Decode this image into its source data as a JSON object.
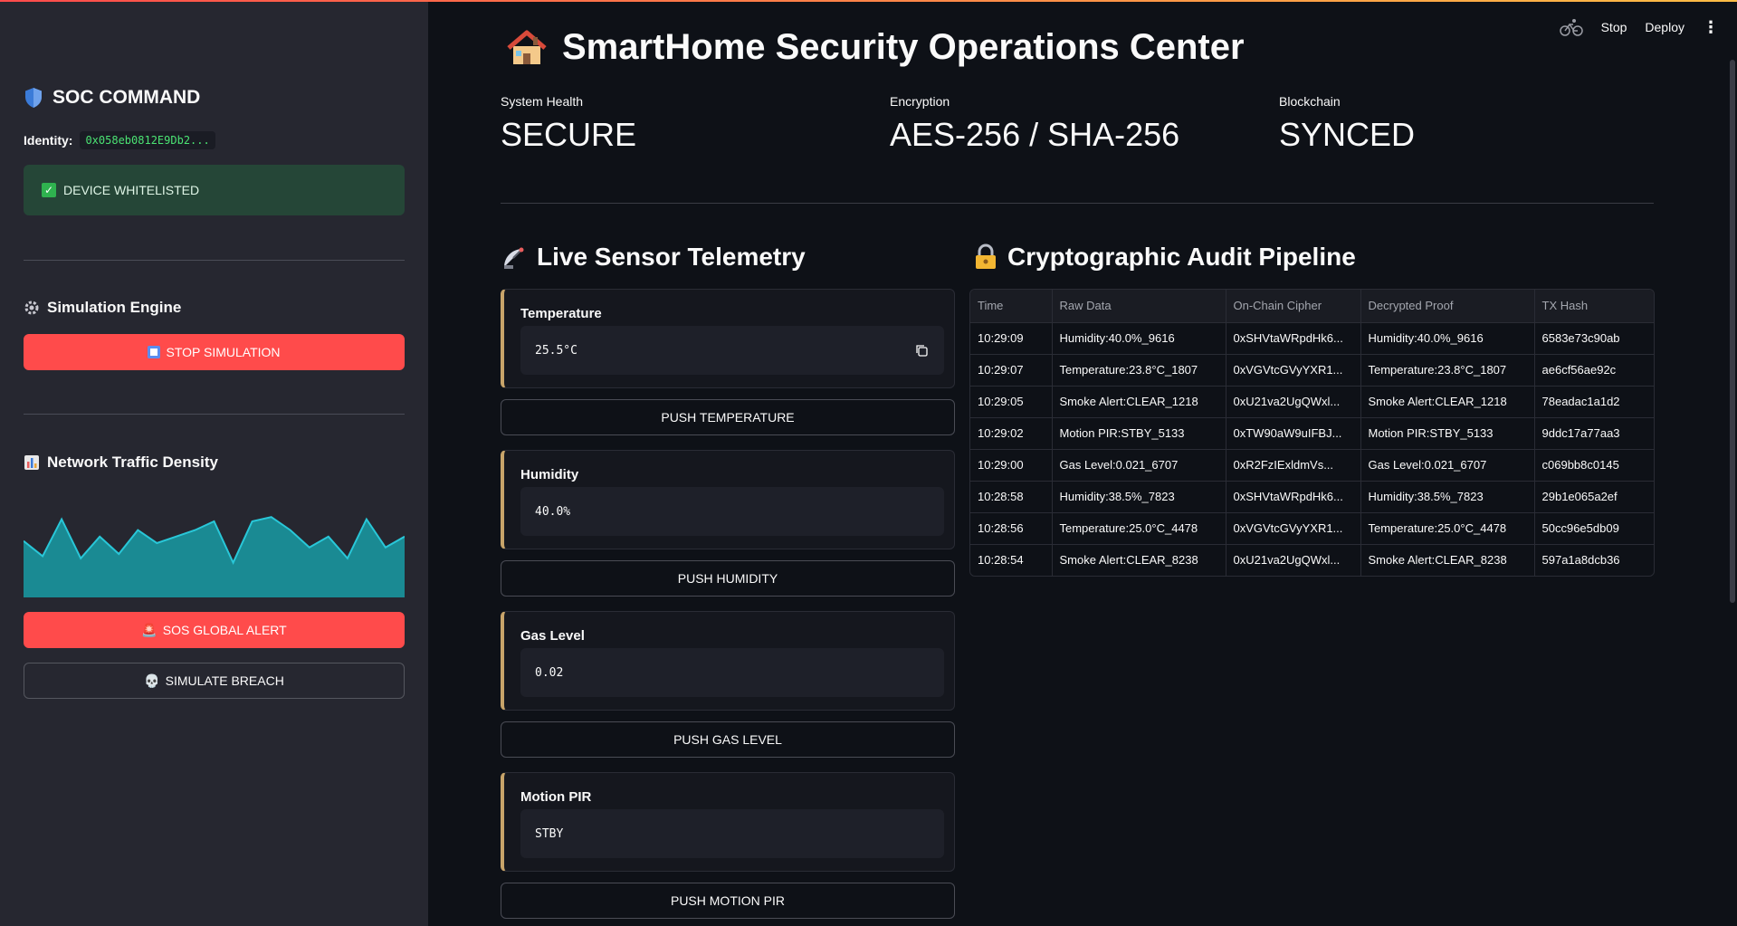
{
  "header": {
    "stop_label": "Stop",
    "deploy_label": "Deploy",
    "menu_label": "⋮"
  },
  "sidebar": {
    "title": "SOC COMMAND",
    "identity_label": "Identity:",
    "identity_value": "0x058eb0812E9Db2...",
    "whitelist_status": "DEVICE WHITELISTED",
    "simulation_heading": "Simulation Engine",
    "stop_simulation_label": "STOP SIMULATION",
    "traffic_heading": "Network Traffic Density",
    "sos_label": "SOS GLOBAL ALERT",
    "breach_label": "SIMULATE BREACH",
    "traffic_series": [
      0.52,
      0.38,
      0.72,
      0.36,
      0.56,
      0.4,
      0.62,
      0.5,
      0.56,
      0.62,
      0.7,
      0.32,
      0.7,
      0.74,
      0.62,
      0.46,
      0.56,
      0.36,
      0.72,
      0.46,
      0.56
    ],
    "traffic_color": "#1a8a93",
    "traffic_line_color": "#29c7d8"
  },
  "main": {
    "title": "SmartHome Security Operations Center",
    "metrics": [
      {
        "label": "System Health",
        "value": "SECURE"
      },
      {
        "label": "Encryption",
        "value": "AES-256 / SHA-256"
      },
      {
        "label": "Blockchain",
        "value": "SYNCED"
      }
    ],
    "telemetry_heading": "Live Sensor Telemetry",
    "audit_heading": "Cryptographic Audit Pipeline",
    "sensors": [
      {
        "label": "Temperature",
        "value": "25.5°C",
        "button": "PUSH TEMPERATURE"
      },
      {
        "label": "Humidity",
        "value": "40.0%",
        "button": "PUSH HUMIDITY"
      },
      {
        "label": "Gas Level",
        "value": "0.02",
        "button": "PUSH GAS LEVEL"
      },
      {
        "label": "Motion PIR",
        "value": "STBY",
        "button": "PUSH MOTION PIR"
      }
    ],
    "table": {
      "columns": [
        "Time",
        "Raw Data",
        "On-Chain Cipher",
        "Decrypted Proof",
        "TX Hash"
      ],
      "rows": [
        [
          "10:29:09",
          "Humidity:40.0%_9616",
          "0xSHVtaWRpdHk6...",
          "Humidity:40.0%_9616",
          "6583e73c90ab"
        ],
        [
          "10:29:07",
          "Temperature:23.8°C_1807",
          "0xVGVtcGVyYXR1...",
          "Temperature:23.8°C_1807",
          "ae6cf56ae92c"
        ],
        [
          "10:29:05",
          "Smoke Alert:CLEAR_1218",
          "0xU21va2UgQWxl...",
          "Smoke Alert:CLEAR_1218",
          "78eadac1a1d2"
        ],
        [
          "10:29:02",
          "Motion PIR:STBY_5133",
          "0xTW90aW9uIFBJ...",
          "Motion PIR:STBY_5133",
          "9ddc17a77aa3"
        ],
        [
          "10:29:00",
          "Gas Level:0.021_6707",
          "0xR2FzIExldmVs...",
          "Gas Level:0.021_6707",
          "c069bb8c0145"
        ],
        [
          "10:28:58",
          "Humidity:38.5%_7823",
          "0xSHVtaWRpdHk6...",
          "Humidity:38.5%_7823",
          "29b1e065a2ef"
        ],
        [
          "10:28:56",
          "Temperature:25.0°C_4478",
          "0xVGVtcGVyYXR1...",
          "Temperature:25.0°C_4478",
          "50cc96e5db09"
        ],
        [
          "10:28:54",
          "Smoke Alert:CLEAR_8238",
          "0xU21va2UgQWxl...",
          "Smoke Alert:CLEAR_8238",
          "597a1a8dcb36"
        ]
      ]
    }
  }
}
